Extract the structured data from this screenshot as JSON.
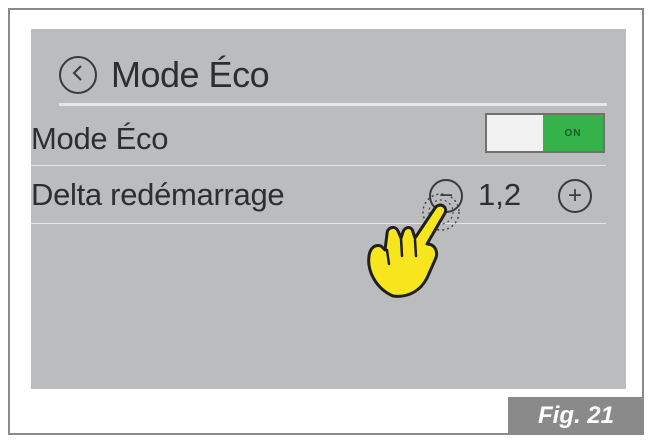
{
  "header": {
    "title": "Mode Éco",
    "back_icon": "chevron-left-icon"
  },
  "settings": {
    "eco_mode": {
      "label": "Mode Éco",
      "state_label": "ON",
      "on": true
    },
    "restart_delta": {
      "label": "Delta redémarrage",
      "value": "1,2",
      "minus_icon": "minus-icon",
      "plus_icon": "plus-icon"
    }
  },
  "colors": {
    "screen_bg": "#bbbcbe",
    "toggle_on": "#35b34a",
    "pointer_hand": "#f7e61d"
  },
  "caption": "Fig. 21"
}
